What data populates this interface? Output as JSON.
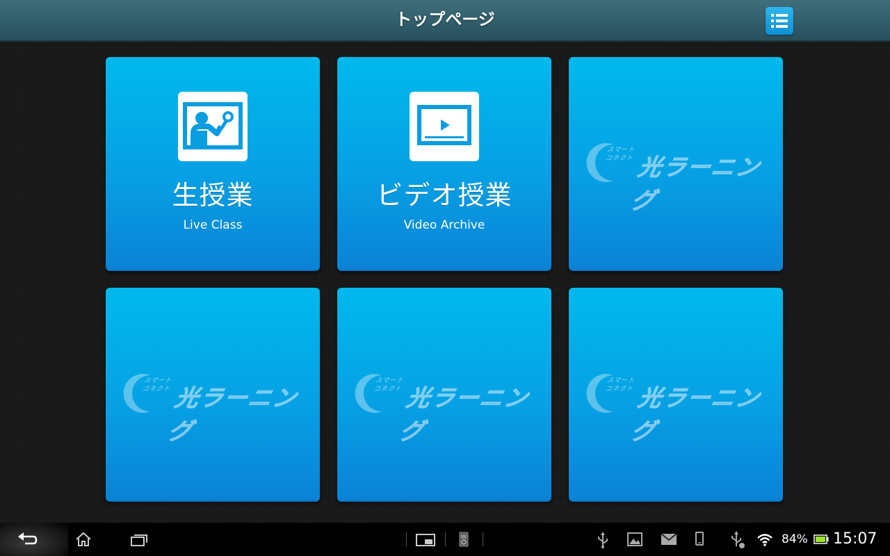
{
  "header": {
    "title": "トップページ",
    "menu_icon": "list-menu-icon"
  },
  "tiles": [
    {
      "title": "生授業",
      "subtitle": "Live Class",
      "icon": "teacher-board-icon"
    },
    {
      "title": "ビデオ授業",
      "subtitle": "Video Archive",
      "icon": "video-player-icon"
    },
    {
      "logo_main": "光ラーニング",
      "logo_small_1": "スマート",
      "logo_small_2": "コネクト"
    },
    {
      "logo_main": "光ラーニング",
      "logo_small_1": "スマート",
      "logo_small_2": "コネクト"
    },
    {
      "logo_main": "光ラーニング",
      "logo_small_1": "スマート",
      "logo_small_2": "コネクト"
    },
    {
      "logo_main": "光ラーニング",
      "logo_small_1": "スマート",
      "logo_small_2": "コネクト"
    }
  ],
  "system_bar": {
    "nav_icons": [
      "back-icon",
      "home-icon",
      "recent-apps-icon",
      "small-app-icon",
      "phone-app-icon"
    ],
    "notification_icons": [
      "usb-icon",
      "gallery-icon",
      "email-icon",
      "phone-icon",
      "usb-debug-icon"
    ],
    "battery": "84%",
    "time": "15:07"
  },
  "colors": {
    "tile_top": "#00b9ec",
    "tile_bottom": "#0a82d6",
    "header": "#2f5e6a",
    "battery_green": "#9be22b"
  }
}
